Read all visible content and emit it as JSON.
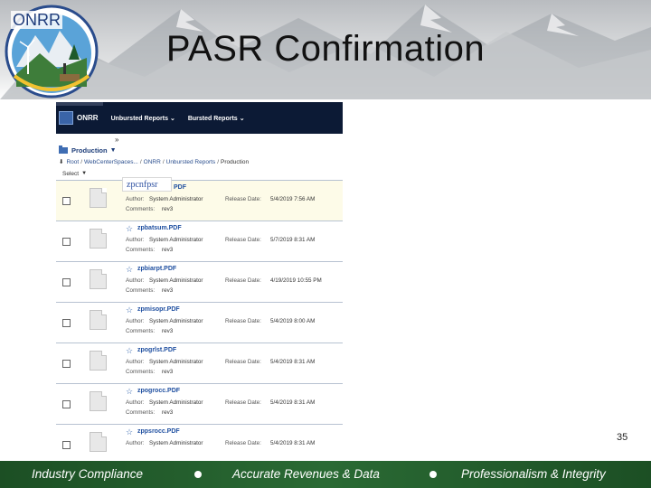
{
  "slide": {
    "title": "PASR Confirmation",
    "page_number": "35",
    "logo_text": "ONRR"
  },
  "app": {
    "nav": {
      "brand": "ONRR",
      "menus": [
        "Unbursted Reports",
        "Bursted Reports"
      ],
      "expand_glyph": "»"
    },
    "folder": {
      "name": "Production",
      "caret": "▼"
    },
    "breadcrumb": {
      "arrow": "⬇",
      "items": [
        "Root",
        "WebCenterSpaces...",
        "ONRR",
        "Unbursted Reports",
        "Production"
      ]
    },
    "select_label": "Select",
    "author_label": "Author:",
    "release_label": "Release Date:",
    "comments_label": "Comments:",
    "files": [
      {
        "name": "zpcnfpsr",
        "ext": "PDF",
        "author": "System Administrator",
        "release": "5/4/2019 7:56 AM",
        "comments": "rev3",
        "editing": true
      },
      {
        "name": "zpbatsum.PDF",
        "author": "System Administrator",
        "release": "5/7/2019 8:31 AM",
        "comments": "rev3"
      },
      {
        "name": "zpbiarpt.PDF",
        "author": "System Administrator",
        "release": "4/19/2019 10:55 PM",
        "comments": "rev3"
      },
      {
        "name": "zpmisopr.PDF",
        "author": "System Administrator",
        "release": "5/4/2019 8:00 AM",
        "comments": "rev3"
      },
      {
        "name": "zpogrlst.PDF",
        "author": "System Administrator",
        "release": "5/4/2019 8:31 AM",
        "comments": "rev3"
      },
      {
        "name": "zpogrocc.PDF",
        "author": "System Administrator",
        "release": "5/4/2019 8:31 AM",
        "comments": "rev3"
      },
      {
        "name": "zppsrocc.PDF",
        "author": "System Administrator",
        "release": "5/4/2019 8:31 AM",
        "comments": ""
      }
    ]
  },
  "footer": {
    "values": [
      "Industry Compliance",
      "Accurate Revenues & Data",
      "Professionalism & Integrity"
    ]
  },
  "colors": {
    "nav_bg": "#0c1a35",
    "footer_bg": "#2a6a34",
    "link": "#1f4fa0"
  }
}
